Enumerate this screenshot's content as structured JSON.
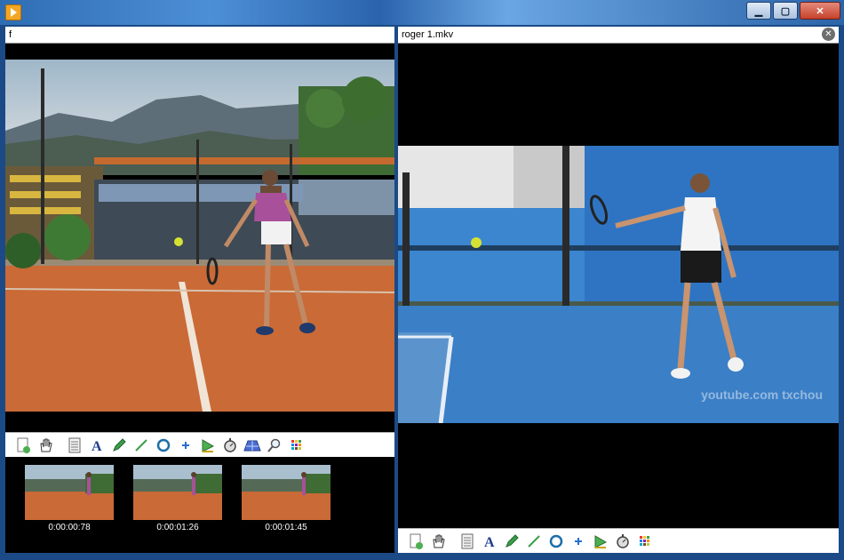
{
  "window": {
    "controls": {
      "minimize": "▁",
      "maximize": "▢",
      "close": "✕"
    }
  },
  "left_pane": {
    "title": "f",
    "thumbnails": [
      {
        "time": "0:00:00:78"
      },
      {
        "time": "0:00:01:26"
      },
      {
        "time": "0:00:01:45"
      }
    ]
  },
  "right_pane": {
    "title": "roger 1.mkv",
    "close_label": "✕",
    "watermark": "youtube.com txchou"
  },
  "toolbar_icons": {
    "left": [
      "new-key-image-icon",
      "hand-icon",
      "notes-icon",
      "text-icon",
      "pencil-icon",
      "line-icon",
      "circle-icon",
      "cross-marker-icon",
      "angle-icon",
      "chronometer-icon",
      "perspective-grid-icon",
      "magnifier-icon",
      "color-palette-icon"
    ],
    "right": [
      "new-key-image-icon",
      "hand-icon",
      "notes-icon",
      "text-icon",
      "pencil-icon",
      "line-icon",
      "circle-icon",
      "cross-marker-icon",
      "angle-icon",
      "chronometer-icon",
      "color-palette-icon"
    ]
  },
  "colors": {
    "clay_court": "#c96a37",
    "hard_court": "#3b7fc6",
    "shirt_purple": "#a8509a",
    "title_blue": "#2f6db3"
  }
}
